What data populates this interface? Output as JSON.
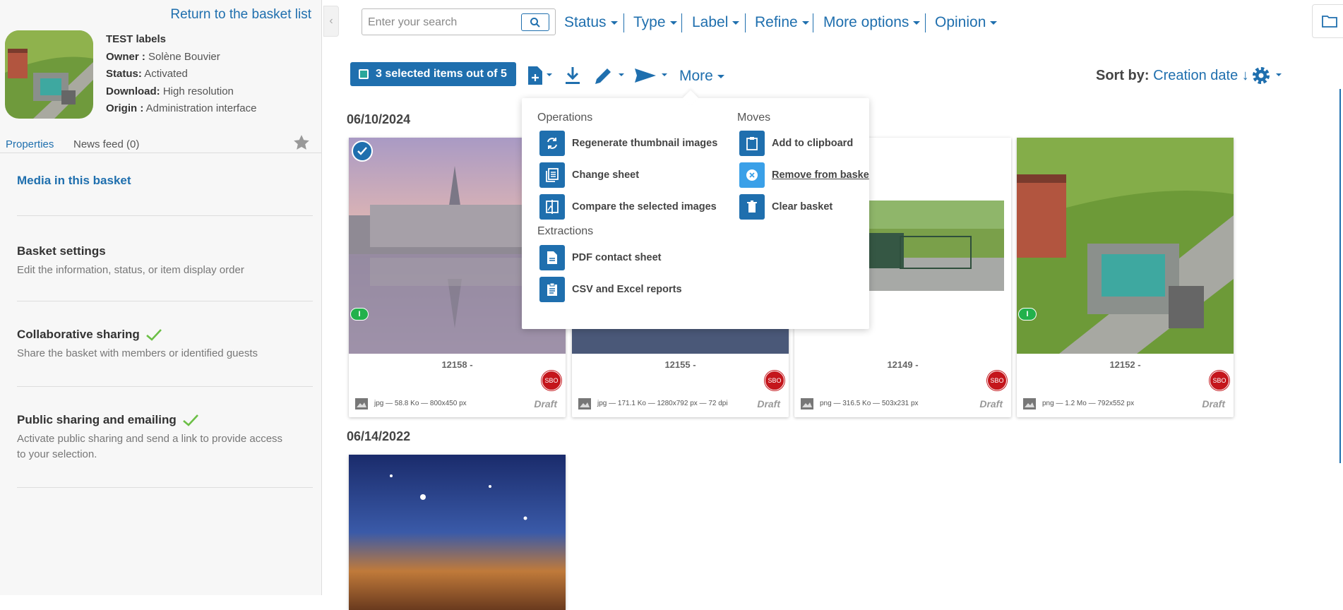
{
  "sidebar": {
    "return_link": "Return to the basket list",
    "basket_title": "TEST labels",
    "owner_label": "Owner :",
    "owner_value": "Solène Bouvier",
    "status_label": "Status:",
    "status_value": "Activated",
    "download_label": "Download:",
    "download_value": "High resolution",
    "origin_label": "Origin :",
    "origin_value": "Administration interface",
    "tabs": [
      {
        "label": "Properties",
        "active": true
      },
      {
        "label": "News feed (0)",
        "active": false
      }
    ],
    "sections": [
      {
        "title": "Media in this basket",
        "desc": ""
      },
      {
        "title": "Basket settings",
        "desc": "Edit the information, status, or item display order"
      },
      {
        "title": "Collaborative sharing",
        "desc": "Share the basket with members or identified guests",
        "check": true
      },
      {
        "title": "Public sharing and emailing",
        "desc": "Activate public sharing and send a link to provide access to your selection.",
        "check": true
      }
    ]
  },
  "search": {
    "placeholder": "Enter your search"
  },
  "filters": [
    "Status",
    "Type",
    "Label",
    "Refine",
    "More options",
    "Opinion"
  ],
  "toolbar": {
    "selection": "3 selected items out of 5",
    "more": "More",
    "sort_label": "Sort by:",
    "sort_value": "Creation date ↓"
  },
  "groups": [
    {
      "date": "06/10/2024"
    },
    {
      "date": "06/14/2022"
    }
  ],
  "cards": [
    {
      "id": "12158 -",
      "info": "jpg — 58.8 Ko — 800x450 px",
      "status": "Draft",
      "badge": "SBO"
    },
    {
      "id": "12155 -",
      "info": "jpg — 171.1 Ko — 1280x792 px — 72 dpi",
      "status": "Draft",
      "badge": "SBO"
    },
    {
      "id": "12149 -",
      "info": "png — 316.5 Ko — 503x231 px",
      "status": "Draft",
      "badge": "SBO"
    },
    {
      "id": "12152 -",
      "info": "png — 1.2 Mo — 792x552 px",
      "status": "Draft",
      "badge": "SBO"
    }
  ],
  "label_badge": "I",
  "dropdown": {
    "operations_title": "Operations",
    "moves_title": "Moves",
    "extractions_title": "Extractions",
    "operations": [
      "Regenerate thumbnail images",
      "Change sheet",
      "Compare the selected images"
    ],
    "moves": [
      "Add to clipboard",
      "Remove from baske",
      "Clear basket"
    ],
    "extractions": [
      "PDF contact sheet",
      "CSV and Excel reports"
    ]
  },
  "colors": {
    "accent": "#1f6fae",
    "badge_red": "#c4161c",
    "label_green": "#22b14c"
  }
}
